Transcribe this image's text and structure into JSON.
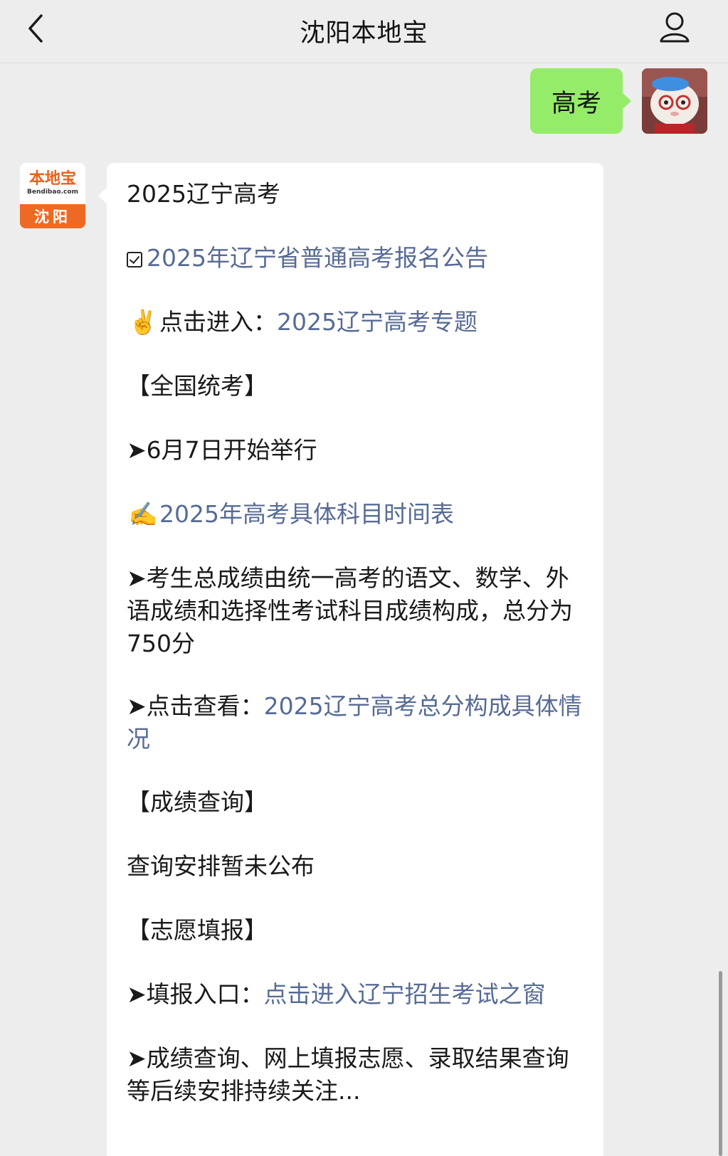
{
  "header": {
    "title": "沈阳本地宝",
    "back_icon": "chevron-left-icon",
    "profile_icon": "person-icon"
  },
  "sent_message": {
    "text": "高考"
  },
  "bot": {
    "logo_main": "本地宝",
    "logo_sub": "Bendibao.com",
    "logo_city": "沈阳"
  },
  "message": {
    "title": "2025辽宁高考",
    "line_registration": "2025年辽宁省普通高考报名公告",
    "line_enter_prefix": "点击进入：",
    "line_enter_link": "2025辽宁高考专题",
    "section_national": "【全国统考】",
    "exam_start": "➤6月7日开始举行",
    "schedule_link": "2025年高考具体科目时间表",
    "score_composition": "➤考生总成绩由统一高考的语文、数学、外语成绩和选择性考试科目成绩构成，总分为750分",
    "view_prefix": "➤点击查看：",
    "view_link": "2025辽宁高考总分构成具体情况",
    "section_score": "【成绩查询】",
    "score_query": "查询安排暂未公布",
    "section_application": "【志愿填报】",
    "application_prefix": "➤填报入口：",
    "application_link": "点击进入辽宁招生考试之窗",
    "follow_up": "➤成绩查询、网上填报志愿、录取结果查询等后续安排持续关注..."
  },
  "colors": {
    "background": "#ededed",
    "sent_bubble": "#95ec69",
    "link": "#576b95",
    "brand": "#ee6a24"
  }
}
